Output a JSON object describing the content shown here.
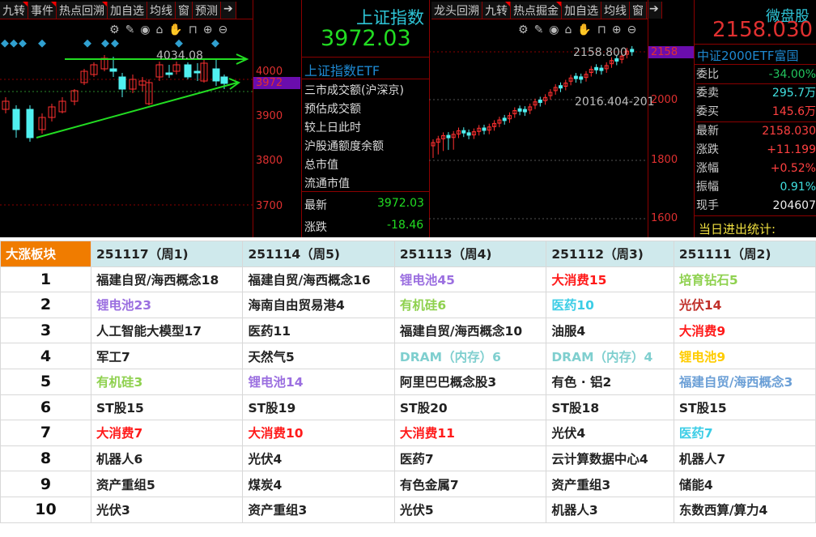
{
  "left_chart": {
    "tabs": [
      "九转",
      "事件",
      "热点回溯",
      "加自选",
      "均线",
      "窗",
      "预测"
    ],
    "high_label": "4034.08",
    "axis": [
      "4000",
      "3900",
      "3800",
      "3700"
    ],
    "price_tag": "3972"
  },
  "index_panel": {
    "title": "上证指数",
    "price": "3972.03",
    "etf": "上证指数ETF",
    "rows": [
      "三市成交额(沪深京)",
      "预估成交额",
      "较上日此时",
      "沪股通额度余额",
      "总市值",
      "流通市值"
    ],
    "latest_label": "最新",
    "latest_value": "3972.03",
    "change_label": "涨跌",
    "change_value": "-18.46"
  },
  "mid_chart": {
    "tabs": [
      "龙头回溯",
      "九转",
      "热点掘金",
      "加自选",
      "均线",
      "窗"
    ],
    "high_label": "2158.800",
    "low_label": "2016.404-201",
    "axis": [
      "2000",
      "1800",
      "1600"
    ],
    "price_tag": "2158"
  },
  "right_panel": {
    "title": "微盘股",
    "price": "2158.030",
    "etf": "中证2000ETF富国",
    "rows": [
      {
        "label": "委比",
        "value": "-34.00%",
        "color": "#22c55e"
      },
      {
        "label": "委卖",
        "value": "295.7万",
        "color": "#40e0e0"
      },
      {
        "label": "委买",
        "value": "145.6万",
        "color": "#ff4040"
      },
      {
        "label": "最新",
        "value": "2158.030",
        "color": "#ff4040"
      },
      {
        "label": "涨跌",
        "value": "+11.199",
        "color": "#ff4040"
      },
      {
        "label": "涨幅",
        "value": "+0.52%",
        "color": "#ff4040"
      },
      {
        "label": "振幅",
        "value": "0.91%",
        "color": "#40e0e0"
      },
      {
        "label": "现手",
        "value": "204607",
        "color": "#eee"
      }
    ],
    "stats": "当日进出统计:"
  },
  "table": {
    "corner": "大涨板块",
    "headers": [
      "251117（周1)",
      "251114（周5)",
      "251113（周4)",
      "251112（周3)",
      "251111（周2)"
    ],
    "rows": [
      {
        "rank": "1",
        "cells": [
          [
            "福建自贸/海西概念18",
            "#222"
          ],
          [
            "福建自贸/海西概念16",
            "#222"
          ],
          [
            "锂电池45",
            "#9b6fe0"
          ],
          [
            "大消费15",
            "#ff1a1a"
          ],
          [
            "培育钻石5",
            "#8fd14f"
          ]
        ]
      },
      {
        "rank": "2",
        "cells": [
          [
            "锂电池23",
            "#9b6fe0"
          ],
          [
            "海南自由贸易港4",
            "#222"
          ],
          [
            "有机硅6",
            "#8fd14f"
          ],
          [
            "医药10",
            "#3ccde6"
          ],
          [
            "光伏14",
            "#c0302a"
          ]
        ]
      },
      {
        "rank": "3",
        "cells": [
          [
            "人工智能大模型17",
            "#222"
          ],
          [
            "医药11",
            "#222"
          ],
          [
            "福建自贸/海西概念10",
            "#222"
          ],
          [
            "油服4",
            "#222"
          ],
          [
            "大消费9",
            "#ff1a1a"
          ]
        ]
      },
      {
        "rank": "4",
        "cells": [
          [
            "军工7",
            "#222"
          ],
          [
            "天然气5",
            "#222"
          ],
          [
            "DRAM（内存）6",
            "#7fcfcf"
          ],
          [
            "DRAM（内存）4",
            "#7fcfcf"
          ],
          [
            "锂电池9",
            "#ffcc00"
          ]
        ]
      },
      {
        "rank": "5",
        "cells": [
          [
            "有机硅3",
            "#8fd14f"
          ],
          [
            "锂电池14",
            "#9b6fe0"
          ],
          [
            "阿里巴巴概念股3",
            "#222"
          ],
          [
            "有色 · 铝2",
            "#222"
          ],
          [
            "福建自贸/海西概念3",
            "#6b9fd6"
          ]
        ]
      },
      {
        "rank": "6",
        "cells": [
          [
            "ST股15",
            "#222"
          ],
          [
            "ST股19",
            "#222"
          ],
          [
            "ST股20",
            "#222"
          ],
          [
            "ST股18",
            "#222"
          ],
          [
            "ST股15",
            "#222"
          ]
        ]
      },
      {
        "rank": "7",
        "cells": [
          [
            "大消费7",
            "#ff1a1a"
          ],
          [
            "大消费10",
            "#ff1a1a"
          ],
          [
            "大消费11",
            "#ff1a1a"
          ],
          [
            "光伏4",
            "#222"
          ],
          [
            "医药7",
            "#3ccde6"
          ]
        ]
      },
      {
        "rank": "8",
        "cells": [
          [
            "机器人6",
            "#222"
          ],
          [
            "光伏4",
            "#222"
          ],
          [
            "医药7",
            "#222"
          ],
          [
            "云计算数据中心4",
            "#222"
          ],
          [
            "机器人7",
            "#222"
          ]
        ]
      },
      {
        "rank": "9",
        "cells": [
          [
            "资产重组5",
            "#222"
          ],
          [
            "煤炭4",
            "#222"
          ],
          [
            "有色金属7",
            "#222"
          ],
          [
            "资产重组3",
            "#222"
          ],
          [
            "储能4",
            "#222"
          ]
        ]
      },
      {
        "rank": "10",
        "cells": [
          [
            "光伏3",
            "#222"
          ],
          [
            "资产重组3",
            "#222"
          ],
          [
            "光伏5",
            "#222"
          ],
          [
            "机器人3",
            "#222"
          ],
          [
            "东数西算/算力4",
            "#222"
          ]
        ]
      }
    ]
  }
}
